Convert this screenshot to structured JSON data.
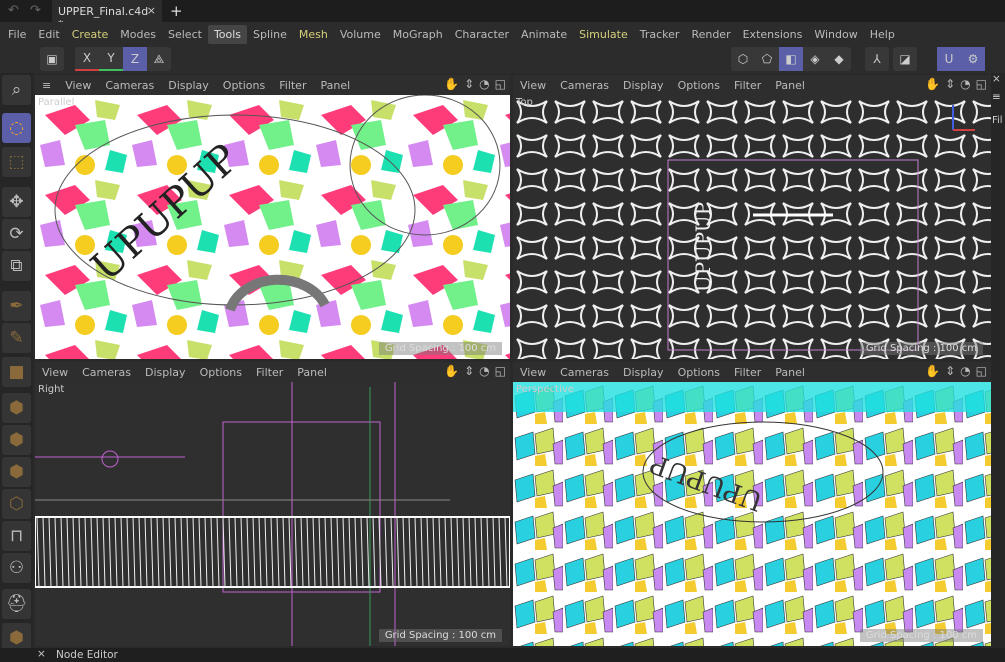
{
  "titlebar": {
    "document_tab": "UPPER_Final.c4d *",
    "close": "×",
    "new_tab": "+",
    "undo": "↶",
    "redo": "↷"
  },
  "menu": [
    "File",
    "Edit",
    "Create",
    "Modes",
    "Select",
    "Tools",
    "Spline",
    "Mesh",
    "Volume",
    "MoGraph",
    "Character",
    "Animate",
    "Simulate",
    "Tracker",
    "Render",
    "Extensions",
    "Window",
    "Help"
  ],
  "menu_highlighted": [
    "Create",
    "Mesh",
    "Simulate"
  ],
  "menu_active": "Tools",
  "toolbar": {
    "axis_x": "X",
    "axis_y": "Y",
    "axis_z": "Z"
  },
  "viewport_menu": [
    "View",
    "Cameras",
    "Display",
    "Options",
    "Filter",
    "Panel"
  ],
  "viewports": [
    {
      "label": "Parallel",
      "grid": "Grid Spacing : 100 cm",
      "text": "UPUPUP"
    },
    {
      "label": "Top",
      "grid": "Grid Spacing : 100 cm",
      "text": "UPUPUP"
    },
    {
      "label": "Right",
      "grid": "Grid Spacing : 100 cm"
    },
    {
      "label": "Perspective",
      "grid": "Grid Spacing : 100 cm",
      "text": "UPUPUP"
    }
  ],
  "bottom": {
    "close": "×",
    "panel": "Node Editor"
  },
  "right_panel": {
    "label": "Fil"
  },
  "colors": {
    "accent": "#5a5fa8",
    "x_axis": "#d04040",
    "y_axis": "#40c060",
    "z_axis": "#4060e0"
  }
}
